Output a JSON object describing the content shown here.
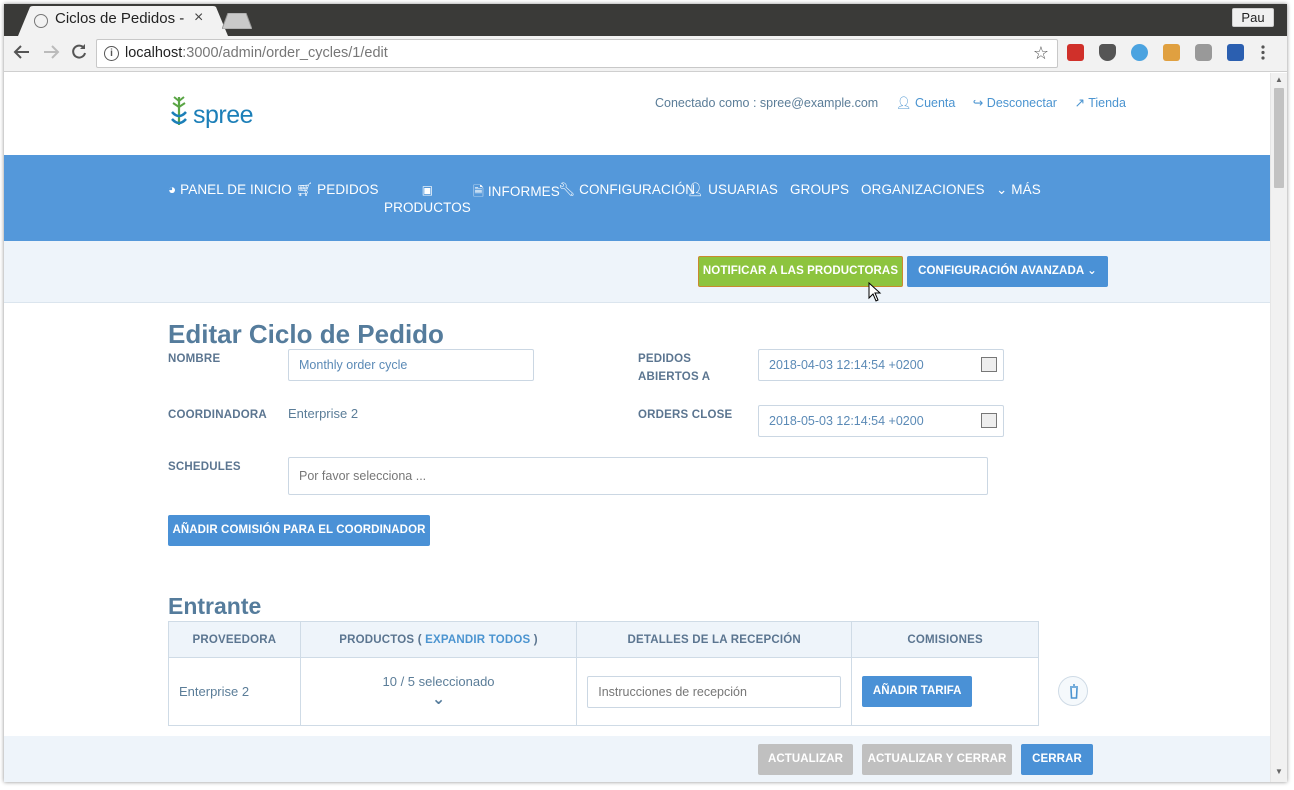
{
  "browser": {
    "tab_title": "Ciclos de Pedidos - (",
    "tab_close": "×",
    "profile": "Pau",
    "url_host": "localhost",
    "url_path": ":3000/admin/order_cycles/1/edit",
    "info_glyph": "i",
    "star": "☆"
  },
  "header": {
    "logo_text": "spree",
    "logged_in": "Conectado como : spree@example.com",
    "account": "Cuenta",
    "logout": "Desconectar",
    "store": "Tienda"
  },
  "nav": {
    "dashboard": "PANEL DE INICIO",
    "orders": "PEDIDOS",
    "products": "PRODUCTOS",
    "reports": "INFORMES",
    "configuration": "CONFIGURACIÓN",
    "users": "USUARIAS",
    "groups": "GROUPS",
    "organizations": "ORGANIZACIONES",
    "more": "MÁS"
  },
  "actions": {
    "notify": "NOTIFICAR A LAS PRODUCTORAS",
    "advanced": "CONFIGURACIÓN AVANZADA"
  },
  "form": {
    "title": "Editar Ciclo de Pedido",
    "name_label": "NOMBRE",
    "name_value": "Monthly order cycle",
    "opens_label_1": "PEDIDOS",
    "opens_label_2": "ABIERTOS A",
    "opens_value": "2018-04-03 12:14:54 +0200",
    "coordinator_label": "COORDINADORA",
    "coordinator_value": "Enterprise 2",
    "closes_label": "ORDERS CLOSE",
    "closes_value": "2018-05-03 12:14:54 +0200",
    "schedules_label": "SCHEDULES",
    "schedules_placeholder": "Por favor selecciona ...",
    "add_fee": "AÑADIR COMISIÓN PARA EL COORDINADOR"
  },
  "incoming": {
    "title": "Entrante",
    "col_supplier": "PROVEEDORA",
    "col_products_prefix": "PRODUCTOS (",
    "col_products_link": "EXPANDIR TODOS",
    "col_products_suffix": ")",
    "col_receipt": "DETALLES DE LA RECEPCIÓN",
    "col_fees": "COMISIONES",
    "rows": [
      {
        "supplier": "Enterprise 2",
        "products": "10 / 5 seleccionado",
        "receipt_placeholder": "Instrucciones de recepción",
        "add_fee": "AÑADIR TARIFA"
      }
    ]
  },
  "footer": {
    "update": "ACTUALIZAR",
    "update_close": "ACTUALIZAR Y CERRAR",
    "close": "CERRAR"
  },
  "colors": {
    "nav_blue": "#5498da",
    "button_blue": "#4a91d6",
    "notify_green": "#8dc43e",
    "disabled_grey": "#c0c0c0",
    "heading": "#557c9c"
  }
}
